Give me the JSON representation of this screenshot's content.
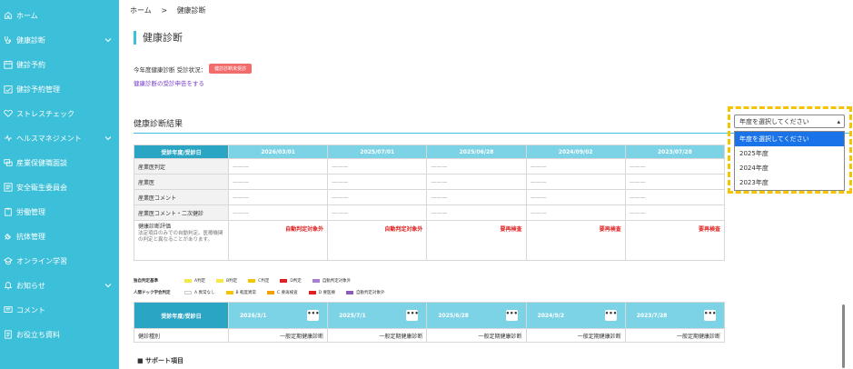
{
  "sidebar": {
    "items": [
      {
        "label": "ホーム",
        "icon": "home-icon",
        "chevron": false
      },
      {
        "label": "健康診断",
        "icon": "stethoscope-icon",
        "chevron": true
      },
      {
        "label": "健診予約",
        "icon": "calendar-icon",
        "chevron": false
      },
      {
        "label": "健診予約管理",
        "icon": "calendar-check-icon",
        "chevron": false
      },
      {
        "label": "ストレスチェック",
        "icon": "heart-icon",
        "chevron": false
      },
      {
        "label": "ヘルスマネジメント",
        "icon": "health-icon",
        "chevron": true
      },
      {
        "label": "産業保健職面談",
        "icon": "interview-icon",
        "chevron": false
      },
      {
        "label": "安全衛生委員会",
        "icon": "committee-icon",
        "chevron": false
      },
      {
        "label": "労働管理",
        "icon": "clipboard-icon",
        "chevron": false
      },
      {
        "label": "抗体管理",
        "icon": "syringe-icon",
        "chevron": false
      },
      {
        "label": "オンライン学習",
        "icon": "graduation-icon",
        "chevron": false
      },
      {
        "label": "お知らせ",
        "icon": "bell-icon",
        "chevron": true
      },
      {
        "label": "コメント",
        "icon": "comment-icon",
        "chevron": false
      },
      {
        "label": "お役立ち資料",
        "icon": "document-icon",
        "chevron": false
      }
    ]
  },
  "breadcrumb": {
    "home": "ホーム",
    "sep": ">",
    "current": "健康診断"
  },
  "page_title": "健康診断",
  "status": {
    "label": "今年度健康診断 受診状況：",
    "badge": "健診診断未受診"
  },
  "apply_link": "健康診断の受診申告をする",
  "results_title": "健康診断結果",
  "table1": {
    "header_first": "受診年度/受診日",
    "dates": [
      "2026/03/01",
      "2025/07/01",
      "2025/06/28",
      "2024/09/02",
      "2023/07/28"
    ],
    "rows": [
      {
        "label": "産業医判定"
      },
      {
        "label": "産業医"
      },
      {
        "label": "産業医コメント"
      },
      {
        "label": "産業医コメント・二次健診"
      }
    ],
    "dash": "———",
    "eval_label": "健康診断評価",
    "eval_sub": "法定項目のみでの自動判定。医療機関の判定と異なることがあります。",
    "evals": [
      "自動判定対象外",
      "自動判定対象外",
      "要再検査",
      "要再検査",
      "要再検査"
    ]
  },
  "legend1": {
    "title": "独自判定基準",
    "items": [
      {
        "label": "A判定",
        "color": "#f7e84a"
      },
      {
        "label": "B判定",
        "color": "#f7e84a"
      },
      {
        "label": "C判定",
        "color": "#f5c400"
      },
      {
        "label": "D判定",
        "color": "#e02020"
      },
      {
        "label": "自動判定対象外",
        "color": "#a97fd6"
      }
    ]
  },
  "legend2": {
    "title": "人間ドック学会判定",
    "items": [
      {
        "label": "A 異常なし",
        "color": "#ffffff"
      },
      {
        "label": "B 軽度異常",
        "color": "#f5c400"
      },
      {
        "label": "C 要再検査",
        "color": "#f5a000"
      },
      {
        "label": "D 要医療",
        "color": "#e02020"
      },
      {
        "label": "自動判定対象外",
        "color": "#8e5bb8"
      }
    ]
  },
  "year_select": {
    "value": "年度を選択してください",
    "options": [
      "年度を選択してください",
      "2025年度",
      "2024年度",
      "2023年度"
    ]
  },
  "table2": {
    "header_first": "受診年度/受診日",
    "dates": [
      "2026/3/1",
      "2025/7/1",
      "2025/6/28",
      "2024/9/2",
      "2023/7/28"
    ],
    "more": "•••",
    "row_label": "健診種別",
    "values": [
      "一般定期健康診断",
      "一般定期健康診断",
      "一般定期健康診断",
      "一般定期健康診断",
      "一般定期健康診断"
    ]
  },
  "support_title": "■ サポート項目"
}
